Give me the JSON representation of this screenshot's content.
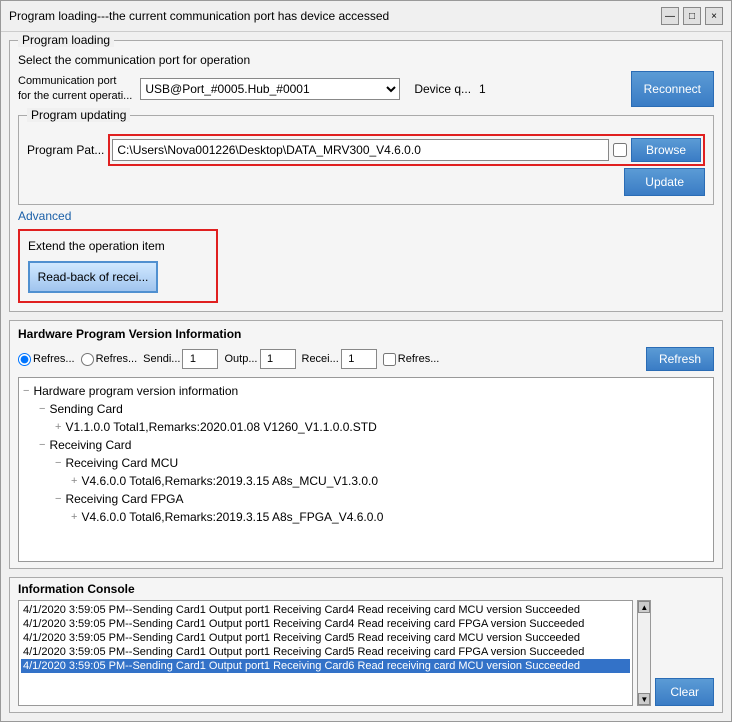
{
  "window": {
    "title": "Program loading---the current communication port has device accessed",
    "controls": [
      "—",
      "□",
      "×"
    ]
  },
  "program_loading": {
    "title": "Program loading",
    "comm_section": {
      "label": "Select the communication port for operation",
      "port_label": "Communication port\nfor the current operati...",
      "port_value": "USB@Port_#0005.Hub_#0001",
      "port_options": [
        "USB@Port_#0005.Hub_#0001"
      ],
      "device_q_label": "Device q...",
      "device_q_value": "1",
      "reconnect_label": "Reconnect"
    },
    "program_updating": {
      "title": "Program updating",
      "path_label": "Program Pat...",
      "path_value": "C:\\Users\\Nova001226\\Desktop\\DATA_MRV300_V4.6.0.0",
      "browse_label": "Browse",
      "update_label": "Update"
    },
    "advanced_label": "Advanced",
    "extend_section": {
      "title": "Extend the operation item",
      "read_back_label": "Read-back of recei..."
    }
  },
  "hardware_version": {
    "title": "Hardware Program Version Information",
    "radio1_label": "Refres...",
    "radio2_label": "Refres...",
    "sending_label": "Sendi...",
    "sending_value": "1",
    "output_label": "Outp...",
    "output_value": "1",
    "receiving_label": "Recei...",
    "receiving_value": "1",
    "checkbox_label": "Refres...",
    "refresh_label": "Refresh",
    "tree": [
      {
        "level": 0,
        "icon": "-",
        "text": "Hardware program version information"
      },
      {
        "level": 1,
        "icon": "-",
        "text": "Sending Card"
      },
      {
        "level": 2,
        "icon": "+",
        "text": "V1.1.0.0 Total1,Remarks:2020.01.08 V1260_V1.1.0.0.STD"
      },
      {
        "level": 1,
        "icon": "-",
        "text": "Receiving Card"
      },
      {
        "level": 2,
        "icon": "-",
        "text": "Receiving Card MCU"
      },
      {
        "level": 3,
        "icon": "+",
        "text": "V4.6.0.0 Total6,Remarks:2019.3.15 A8s_MCU_V1.3.0.0"
      },
      {
        "level": 2,
        "icon": "-",
        "text": "Receiving Card FPGA"
      },
      {
        "level": 3,
        "icon": "+",
        "text": "V4.6.0.0 Total6,Remarks:2019.3.15 A8s_FPGA_V4.6.0.0"
      }
    ]
  },
  "info_console": {
    "title": "Information Console",
    "logs": [
      {
        "text": "4/1/2020 3:59:05 PM--Sending Card1 Output port1 Receiving Card4 Read receiving card MCU version Succeeded",
        "selected": false
      },
      {
        "text": "4/1/2020 3:59:05 PM--Sending Card1 Output port1 Receiving Card4 Read receiving card FPGA version Succeeded",
        "selected": false
      },
      {
        "text": "4/1/2020 3:59:05 PM--Sending Card1 Output port1 Receiving Card5 Read receiving card MCU version Succeeded",
        "selected": false
      },
      {
        "text": "4/1/2020 3:59:05 PM--Sending Card1 Output port1 Receiving Card5 Read receiving card FPGA version Succeeded",
        "selected": false
      },
      {
        "text": "4/1/2020 3:59:05 PM--Sending Card1 Output port1 Receiving Card6 Read receiving card MCU version Succeeded",
        "selected": true
      }
    ],
    "clear_label": "Clear"
  }
}
